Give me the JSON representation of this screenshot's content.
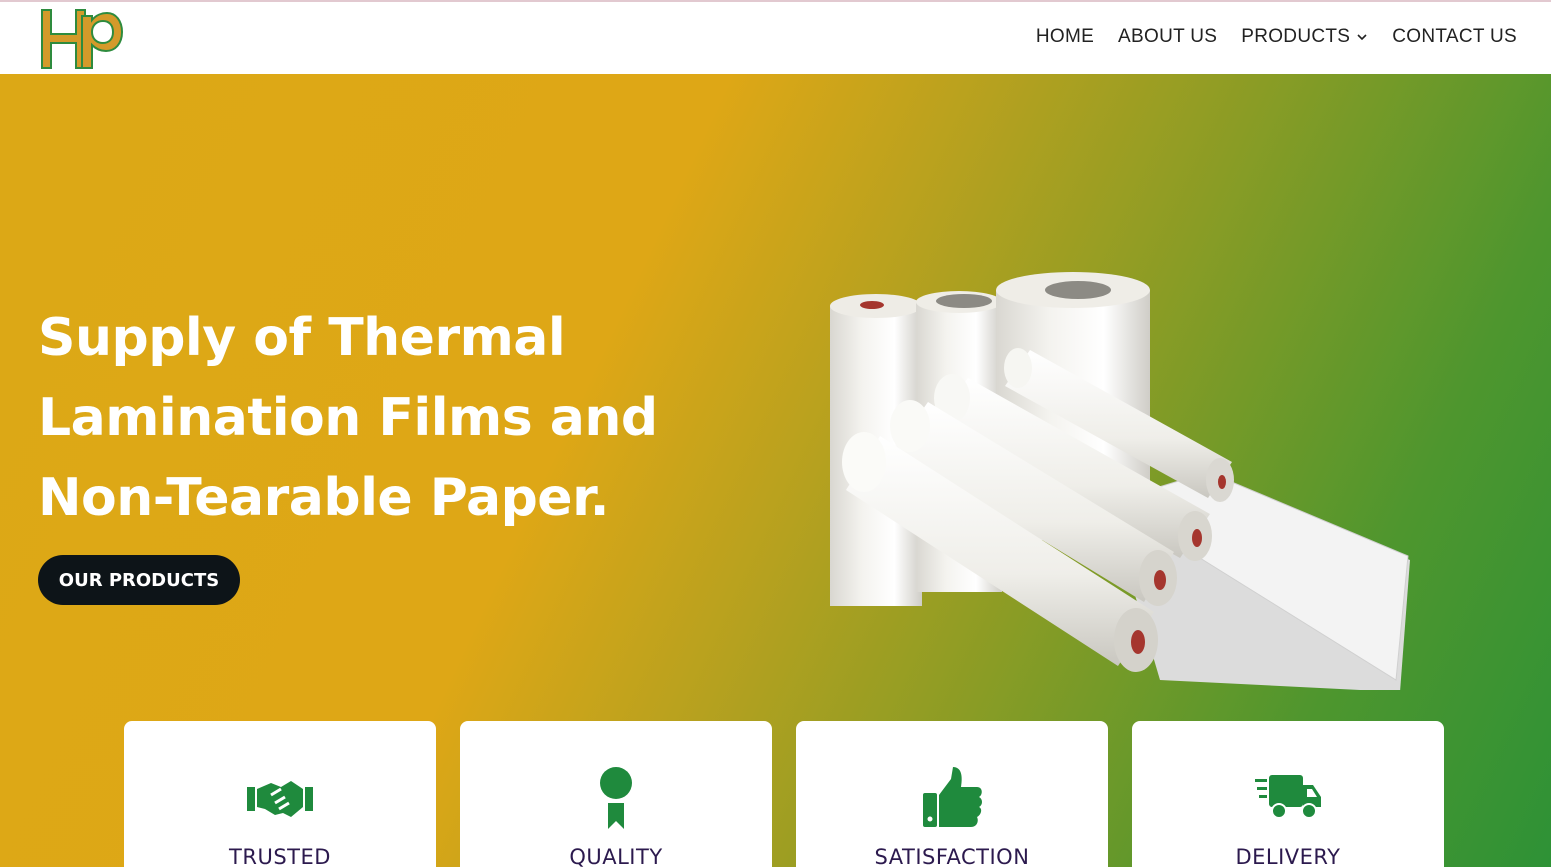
{
  "brand": {
    "logo_text": "HP",
    "logo_color": "#d49a2a",
    "logo_outline": "#2e8b3e"
  },
  "nav": {
    "items": [
      {
        "label": "HOME"
      },
      {
        "label": "ABOUT US"
      },
      {
        "label": "PRODUCTS"
      },
      {
        "label": "CONTACT US"
      }
    ]
  },
  "hero": {
    "headline_lines": [
      "Supply of Thermal",
      "Lamination Films and",
      "Non-Tearable Paper."
    ],
    "cta_label": "OUR PRODUCTS",
    "gradient_start": "#dca816",
    "gradient_end": "#2e9236"
  },
  "features": [
    {
      "title": "TRUSTED",
      "icon": "handshake-icon"
    },
    {
      "title": "QUALITY",
      "icon": "award-ribbon-icon"
    },
    {
      "title": "SATISFACTION",
      "icon": "thumbs-up-icon"
    },
    {
      "title": "DELIVERY",
      "icon": "delivery-truck-icon"
    }
  ],
  "colors": {
    "accent_green": "#1f8a3d",
    "cta_bg": "#0d1418",
    "card_title": "#2c1a4e"
  }
}
